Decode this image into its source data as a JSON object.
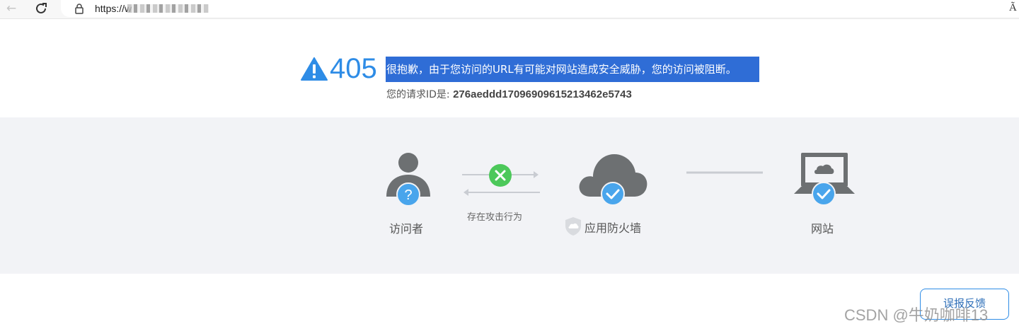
{
  "browser": {
    "url_prefix": "https://w",
    "reader_icon": "Ã"
  },
  "error": {
    "code": "405",
    "message": "很抱歉，由于您访问的URL有可能对网站造成安全威胁，您的访问被阻断。",
    "request_id_label": "您的请求ID是: ",
    "request_id": "276aeddd17096909615213462e5743"
  },
  "flow": {
    "visitor_label": "访问者",
    "attack_label": "存在攻击行为",
    "firewall_label": "应用防火墙",
    "website_label": "网站"
  },
  "feedback_label": "误报反馈",
  "watermark": "CSDN @牛奶咖啡13",
  "colors": {
    "accent": "#2e8ce6",
    "selection": "#2f6dd6",
    "panel": "#f2f3f6",
    "icon_grey": "#6d7072",
    "check_blue": "#49a5ec",
    "block_green": "#4cc85a"
  }
}
